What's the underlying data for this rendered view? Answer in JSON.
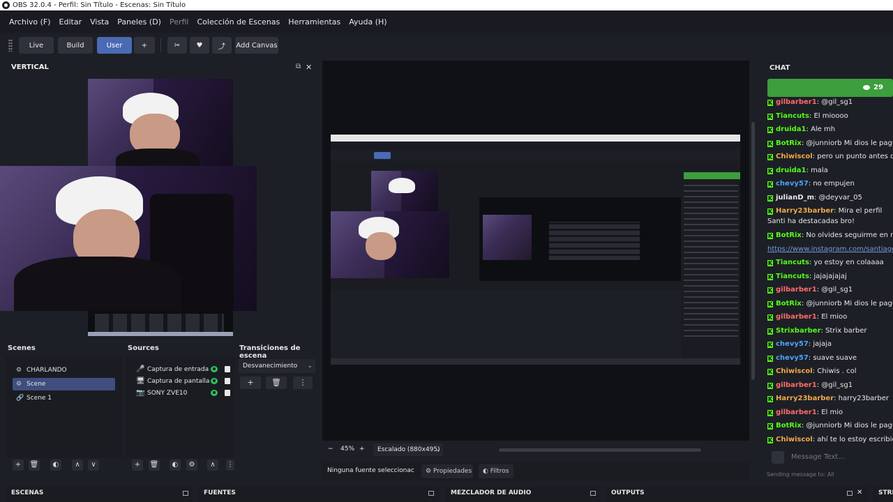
{
  "window": {
    "title": "OBS 32.0.4 - Perfil: Sin Título - Escenas: Sin Título"
  },
  "menu": [
    "Archivo (F)",
    "Editar",
    "Vista",
    "Paneles (D)",
    "Perfil",
    "Colección de Escenas",
    "Herramientas",
    "Ayuda (H)"
  ],
  "toolbar": {
    "tabs": [
      "Live",
      "Build",
      "User"
    ],
    "active_tab": "User",
    "add_label": "+",
    "tools_icon": "✂",
    "heart_icon": "♥",
    "share_icon": "⤴",
    "add_canvas_label": "Add Canvas"
  },
  "vertical": {
    "title": "VERTICAL",
    "float_icon": "⧉",
    "close_icon": "✕"
  },
  "scenes": {
    "title": "Scenes",
    "items": [
      {
        "label": "CHARLANDO",
        "icon": "⚙"
      },
      {
        "label": "Scene",
        "icon": "⚙"
      },
      {
        "label": "Scene 1",
        "icon": "🔗"
      }
    ],
    "selected": "Scene",
    "buttons": {
      "add": "+",
      "remove": "🗑",
      "filter": "◐",
      "up": "∧",
      "down": "∨"
    }
  },
  "sources": {
    "title": "Sources",
    "items": [
      {
        "label": "Captura de entrada d",
        "icon": "🎤"
      },
      {
        "label": "Captura de pantalla",
        "icon": "🖥"
      },
      {
        "label": "SONY ZVE10",
        "icon": "📷"
      }
    ],
    "buttons": {
      "add": "+",
      "remove": "🗑",
      "filter": "◐",
      "settings": "⚙",
      "up": "∧",
      "more": "⋮"
    }
  },
  "transitions": {
    "title": "Transiciones de escena",
    "selected": "Desvanecimiento",
    "add": "+",
    "remove": "🗑",
    "more": "⋮"
  },
  "preview": {
    "zoom_minus": "−",
    "zoom_value": "45%",
    "zoom_plus": "+",
    "scaling": "Escalado (880x495)",
    "no_source": "Ninguna fuente seleccionac",
    "properties": "Propiedades",
    "filters": "Filtros"
  },
  "chat": {
    "title": "CHAT",
    "viewers": "29",
    "messages": [
      {
        "user": "gilbarber1",
        "color": "#ff6b6b",
        "text": ": @gil_sg1"
      },
      {
        "user": "Tiancuts",
        "color": "#53fc18",
        "text": ": El mioooo"
      },
      {
        "user": "druida1",
        "color": "#53fc18",
        "text": ": Ale mh"
      },
      {
        "user": "BotRix",
        "color": "#53fc18",
        "text": ": @junniorb Mi dios le pague <"
      },
      {
        "user": "Chiwiscol",
        "color": "#f0a848",
        "text": ": pero un punto antes del c"
      },
      {
        "user": "druida1",
        "color": "#53fc18",
        "text": ": mala"
      },
      {
        "user": "chevy57",
        "color": "#4ea3ff",
        "text": ": no empujen"
      },
      {
        "user": "julianD_m",
        "color": "#e8e8e8",
        "text": ": @deyvar_05"
      },
      {
        "user": "Harry23barber",
        "color": "#f0a848",
        "text": ": Mira el perfil Santi ha destacadas bro!"
      },
      {
        "user": "BotRix",
        "color": "#53fc18",
        "text": ": No olvides seguirme en mis r"
      },
      {
        "user": "",
        "color": "#6f9bd6",
        "text": "https://www.instagram.com/santiagoser"
      },
      {
        "user": "Tiancuts",
        "color": "#53fc18",
        "text": ": yo estoy en colaaaa"
      },
      {
        "user": "Tiancuts",
        "color": "#53fc18",
        "text": ": jajajajajaj"
      },
      {
        "user": "gilbarber1",
        "color": "#ff6b6b",
        "text": ": @gil_sg1"
      },
      {
        "user": "BotRix",
        "color": "#53fc18",
        "text": ": @junniorb Mi dios le pague <"
      },
      {
        "user": "gilbarber1",
        "color": "#ff6b6b",
        "text": ": El mioo"
      },
      {
        "user": "Strixbarber",
        "color": "#53fc18",
        "text": ": Strix barber"
      },
      {
        "user": "chevy57",
        "color": "#4ea3ff",
        "text": ": jajaja"
      },
      {
        "user": "chevy57",
        "color": "#4ea3ff",
        "text": ": suave suave"
      },
      {
        "user": "Chiwiscol",
        "color": "#f0a848",
        "text": ": Chiwis . col"
      },
      {
        "user": "gilbarber1",
        "color": "#ff6b6b",
        "text": ": @gil_sg1"
      },
      {
        "user": "Harry23barber",
        "color": "#f0a848",
        "text": ": harry23barber"
      },
      {
        "user": "gilbarber1",
        "color": "#ff6b6b",
        "text": ": El mio"
      },
      {
        "user": "BotRix",
        "color": "#53fc18",
        "text": ": @junniorb Mi dios le pague <"
      },
      {
        "user": "Chiwiscol",
        "color": "#f0a848",
        "text": ": ahí te lo estoy escribiendo"
      }
    ],
    "input_placeholder": "Message Text...",
    "sending_to": "Sending message to: All"
  },
  "bottom_docks": [
    "ESCENAS",
    "FUENTES",
    "MEZCLADOR DE AUDIO",
    "OUTPUTS",
    "STRE"
  ],
  "colors": {
    "accent": "#4a6ab4",
    "viewer_bar": "#3c9e3c",
    "kick_green": "#53fc18",
    "eye_green": "#27c45c"
  }
}
